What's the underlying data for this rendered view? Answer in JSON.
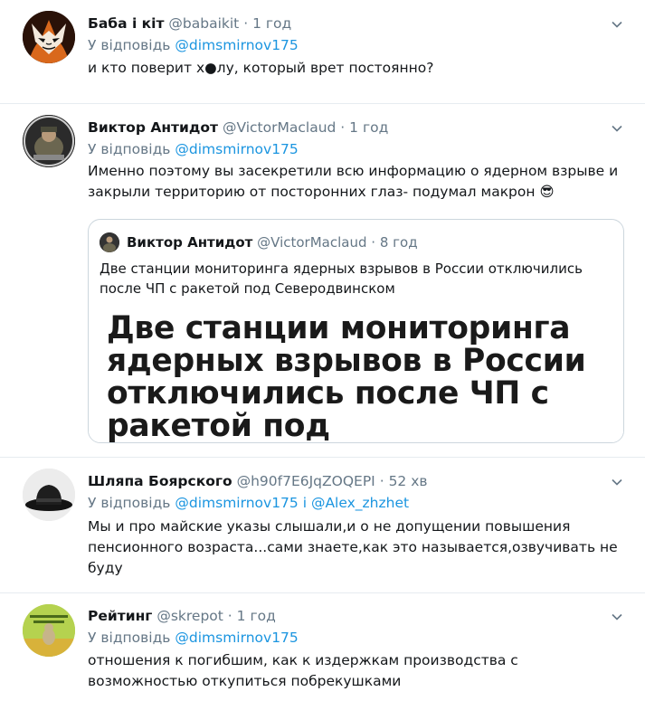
{
  "tweets": [
    {
      "name": "Баба і кіт",
      "handle": "@babaikit",
      "time": "1 год",
      "reply_prefix": "У відповідь",
      "mentions": "@dimsmirnov175",
      "text": "и кто поверит х●лу, который врет постоянно?"
    },
    {
      "name": "Виктор Антидот",
      "handle": "@VictorMaclaud",
      "time": "1 год",
      "reply_prefix": "У відповідь",
      "mentions": "@dimsmirnov175",
      "text": "Именно поэтому вы засекретили всю информацию о ядерном взрыве и закрыли территорию от посторонних глаз- подумал макрон 😎",
      "quote": {
        "name": "Виктор Антидот",
        "handle": "@VictorMaclaud",
        "time": "8 год",
        "text": "Две станции мониторинга ядерных взрывов в России отключились после ЧП с ракетой под Северодвинском",
        "image_headline": "Две станции мониторинга ядерных взрывов в России отключились после ЧП с ракетой под Северодвинском"
      }
    },
    {
      "name": "Шляпа Боярского",
      "handle": "@h90f7E6JqZOQEPI",
      "time": "52 хв",
      "reply_prefix": "У відповідь",
      "mentions": "@dimsmirnov175 і @Alex_zhzhet",
      "text": "Мы и про майские указы слышали,и о не допущении повышения пенсионного возраста...сами знаете,как это называется,озвучивать не буду"
    },
    {
      "name": "Рейтинг",
      "handle": "@skrepot",
      "time": "1 год",
      "reply_prefix": "У відповідь",
      "mentions": "@dimsmirnov175",
      "text": "отношения к погибшим, как к издержкам производства с возможностью откупиться побрекушками"
    }
  ],
  "separator": "·",
  "icons": {
    "more": "chevron-down-icon"
  },
  "colors": {
    "link": "#1b95e0",
    "secondary": "#657786",
    "divider": "#e6ecf0"
  }
}
